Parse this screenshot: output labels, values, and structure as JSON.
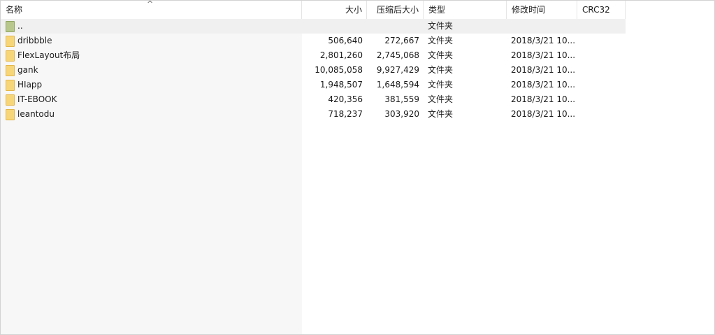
{
  "columns": {
    "name": "名称",
    "size": "大小",
    "packed": "压缩后大小",
    "type": "类型",
    "modified": "修改时间",
    "crc": "CRC32",
    "sort_indicator": "^"
  },
  "parent_row": {
    "name": "..",
    "size": "",
    "packed": "",
    "type": "文件夹",
    "modified": "",
    "crc": ""
  },
  "rows": [
    {
      "name": "dribbble",
      "size": "506,640",
      "packed": "272,667",
      "type": "文件夹",
      "modified": "2018/3/21 10...",
      "crc": ""
    },
    {
      "name": "FlexLayout布局",
      "size": "2,801,260",
      "packed": "2,745,068",
      "type": "文件夹",
      "modified": "2018/3/21 10...",
      "crc": ""
    },
    {
      "name": "gank",
      "size": "10,085,058",
      "packed": "9,927,429",
      "type": "文件夹",
      "modified": "2018/3/21 10...",
      "crc": ""
    },
    {
      "name": "HIapp",
      "size": "1,948,507",
      "packed": "1,648,594",
      "type": "文件夹",
      "modified": "2018/3/21 10...",
      "crc": ""
    },
    {
      "name": "IT-EBOOK",
      "size": "420,356",
      "packed": "381,559",
      "type": "文件夹",
      "modified": "2018/3/21 10...",
      "crc": ""
    },
    {
      "name": "leantodu",
      "size": "718,237",
      "packed": "303,920",
      "type": "文件夹",
      "modified": "2018/3/21 10...",
      "crc": ""
    }
  ],
  "icons": {
    "folder": "folder-icon",
    "parent": "parent-folder-icon"
  },
  "colors": {
    "folder": "#f7d67a",
    "parent_folder": "#b8c88c",
    "name_column_bg": "#f7f7f7"
  }
}
